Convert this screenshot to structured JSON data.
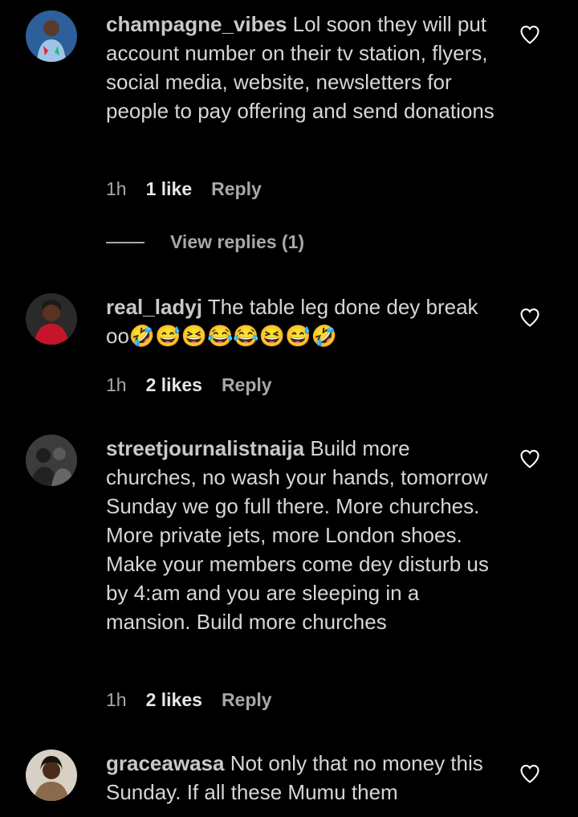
{
  "comments": [
    {
      "username": "champagne_vibes",
      "text": "Lol soon they will put account number on their tv station, flyers, social media, website, newsletters for people to pay offering and send donations",
      "time": "1h",
      "likes": "1 like",
      "reply": "Reply",
      "view_replies": "View replies (1)",
      "avatar_color": "#3a6ea5"
    },
    {
      "username": "real_ladyj",
      "text": "The table leg done dey break oo🤣😅😆😂😂😆😅🤣",
      "time": "1h",
      "likes": "2 likes",
      "reply": "Reply",
      "avatar_color": "#b01e2a"
    },
    {
      "username": "streetjournalistnaija",
      "text": "Build more churches, no wash your hands, tomorrow Sunday we go full there. More churches. More private jets, more London shoes. Make your members come dey disturb us by 4:am and you are sleeping in a mansion. Build more churches",
      "time": "1h",
      "likes": "2 likes",
      "reply": "Reply",
      "avatar_color": "#4a4a4a"
    },
    {
      "username": "graceawasa",
      "text": "Not only that no money this Sunday. If all these Mumu them",
      "avatar_color": "#7a5a40"
    }
  ]
}
